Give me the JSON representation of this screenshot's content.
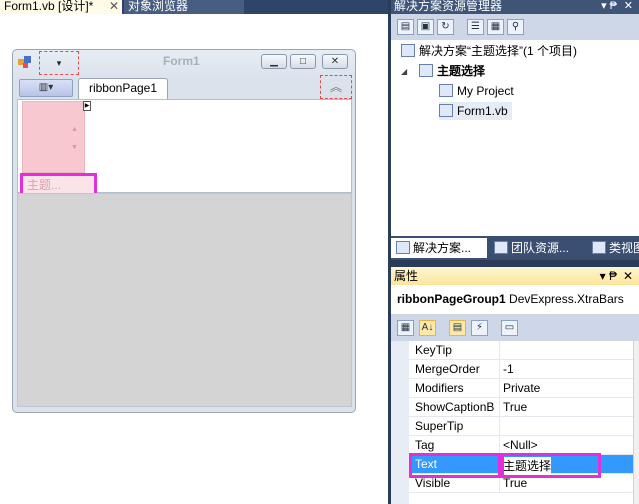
{
  "document_tabs": {
    "form_designer": "Form1.vb [设计]*",
    "close_glyph": "✕",
    "object_browser": "对象浏览器"
  },
  "form": {
    "title": "Form1",
    "qat_dropdown_glyph": "▾",
    "app_menu_glyph": "▥▾",
    "ribbon_tab": "ribbonPage1",
    "minimize_ribbon_glyph": "︽",
    "group_caption": "主题...",
    "window_buttons": {
      "minimize": "▁",
      "maximize": "□",
      "close": "✕"
    }
  },
  "solution_explorer": {
    "title": "解决方案资源管理器",
    "pin_glyph": "▾ ₱",
    "close_glyph": "✕",
    "tree": {
      "solution": "解决方案“主题选择”(1 个项目)",
      "project": "主题选择",
      "my_project": "My Project",
      "form_file": "Form1.vb"
    },
    "tabs": [
      "解决方案...",
      "团队资源...",
      "类视图"
    ]
  },
  "properties": {
    "title": "属性",
    "pin_glyph": "▾ ₱",
    "close_glyph": "✕",
    "object_name": "ribbonPageGroup1",
    "object_type": "DevExpress.XtraBars",
    "rows": [
      {
        "name": "KeyTip",
        "value": ""
      },
      {
        "name": "MergeOrder",
        "value": "-1"
      },
      {
        "name": "Modifiers",
        "value": "Private"
      },
      {
        "name": "ShowCaptionButton",
        "value": "True"
      },
      {
        "name": "SuperTip",
        "value": ""
      },
      {
        "name": "Tag",
        "value": "<Null>"
      },
      {
        "name": "Text",
        "value": "主题选择"
      },
      {
        "name": "Visible",
        "value": "True"
      }
    ],
    "selected_property": "Text"
  },
  "colors": {
    "ide_background": "#2b3c59",
    "selection": "#3399ff",
    "highlight_box": "#e22fd8",
    "group_fill": "#f7c8cf",
    "designer_dashed": "#e14b4b"
  }
}
